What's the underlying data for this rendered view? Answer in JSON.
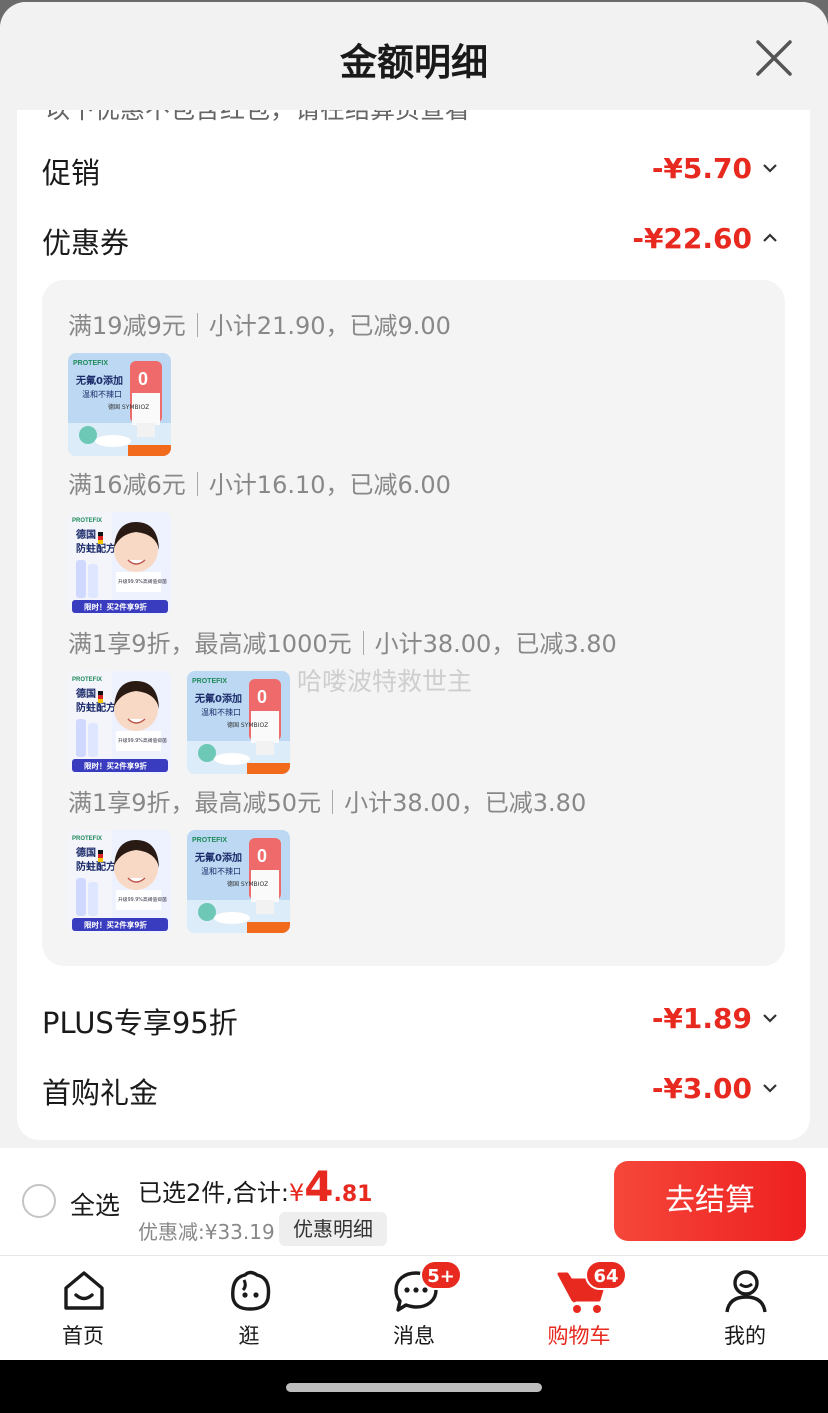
{
  "sheet": {
    "title": "金额明细",
    "cut_text": "以下优惠不包含红包，请在结算页查看"
  },
  "rows": {
    "promo": {
      "label": "促销",
      "amount": "-¥5.70"
    },
    "coupon": {
      "label": "优惠券",
      "amount": "-¥22.60"
    },
    "plus": {
      "label": "PLUS专享95折",
      "amount": "-¥1.89"
    },
    "first": {
      "label": "首购礼金",
      "amount": "-¥3.00"
    }
  },
  "coupons": [
    {
      "rule": "满19减9元",
      "detail": "小计21.90，已减9.00"
    },
    {
      "rule": "满16减6元",
      "detail": "小计16.10，已减6.00"
    },
    {
      "rule": "满1享9折，最高减1000元",
      "detail": "小计38.00，已减3.80"
    },
    {
      "rule": "满1享9折，最高减50元",
      "detail": "小计38.00，已减3.80"
    }
  ],
  "watermark": "哈喽波特救世主",
  "products": {
    "toothpaste": {
      "brand": "PROTEFIX",
      "line1": "无氟0添加",
      "line2": "温和不辣口",
      "badge_text": "0",
      "tag": "德国 SYMBIOZ"
    },
    "kids": {
      "brand": "PROTEFIX",
      "line1": "德国",
      "line2": "防蛀配方",
      "strip": "升级99.9%高阀值抑菌",
      "promo": "限时！买2件享9折"
    }
  },
  "bottom_bar": {
    "select_all": "全选",
    "summary_prefix": "已选2件,合计:",
    "currency": "¥",
    "total_int": "4",
    "total_dec": ".81",
    "discount": "优惠减:¥33.19",
    "detail_button": "优惠明细",
    "checkout_button": "去结算"
  },
  "tabs": [
    {
      "label": "首页",
      "icon": "home-icon"
    },
    {
      "label": "逛",
      "icon": "browse-face-icon"
    },
    {
      "label": "消息",
      "icon": "message-icon",
      "badge": "5+"
    },
    {
      "label": "购物车",
      "icon": "cart-icon",
      "badge": "64"
    },
    {
      "label": "我的",
      "icon": "profile-icon"
    }
  ],
  "colors": {
    "accent": "#e8291f",
    "background": "#f2f2f2"
  }
}
